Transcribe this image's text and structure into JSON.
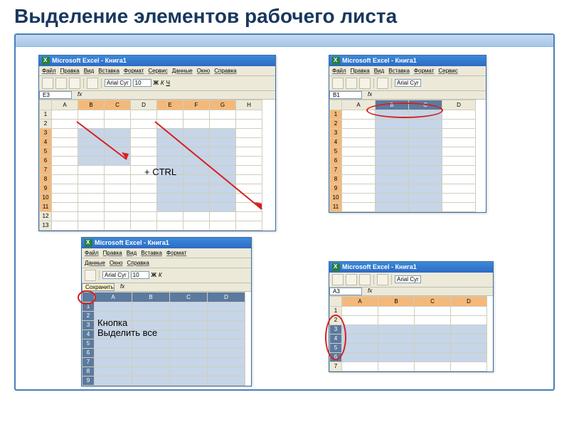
{
  "title": "Выделение элементов рабочего листа",
  "windows": {
    "w1": {
      "title": "Microsoft Excel - Книга1",
      "menu": [
        "Файл",
        "Правка",
        "Вид",
        "Вставка",
        "Формат",
        "Сервис",
        "Данные",
        "Окно",
        "Справка"
      ],
      "font": "Arial Cyr",
      "size": "10",
      "bold": "Ж",
      "italic": "К",
      "underline": "Ч",
      "cellref": "E3",
      "cols": [
        "A",
        "B",
        "C",
        "D",
        "E",
        "F",
        "G",
        "H"
      ],
      "rows": [
        "1",
        "2",
        "3",
        "4",
        "5",
        "6",
        "7",
        "8",
        "9",
        "10",
        "11",
        "12",
        "13"
      ],
      "annot": "+ CTRL"
    },
    "w2": {
      "title": "Microsoft Excel - Книга1",
      "menu": [
        "Файл",
        "Правка",
        "Вид",
        "Вставка",
        "Формат",
        "Сервис"
      ],
      "font": "Arial Cyr",
      "cellref": "B1",
      "cols": [
        "A",
        "B",
        "C",
        "D"
      ],
      "rows": [
        "1",
        "2",
        "3",
        "4",
        "5",
        "6",
        "7",
        "8",
        "9",
        "10",
        "11"
      ]
    },
    "w3": {
      "title": "Microsoft Excel - Книга1",
      "menu": [
        "Файл",
        "Правка",
        "Вид",
        "Вставка",
        "Формат"
      ],
      "menu2": [
        "Данные",
        "Окно",
        "Справка"
      ],
      "font": "Arial Cyr",
      "size": "10",
      "bold": "Ж",
      "italic": "К",
      "tooltip": "Сохранить",
      "cols": [
        "A",
        "B",
        "C",
        "D"
      ],
      "rows": [
        "1",
        "2",
        "3",
        "4",
        "5",
        "6",
        "7",
        "8",
        "9"
      ],
      "annot1": "Кнопка",
      "annot2": "Выделить все"
    },
    "w4": {
      "title": "Microsoft Excel - Книга1",
      "font": "Arial Cyr",
      "cellref": "A3",
      "cols": [
        "A",
        "B",
        "C",
        "D"
      ],
      "rows": [
        "1",
        "2",
        "3",
        "4",
        "5",
        "6",
        "7"
      ]
    }
  }
}
